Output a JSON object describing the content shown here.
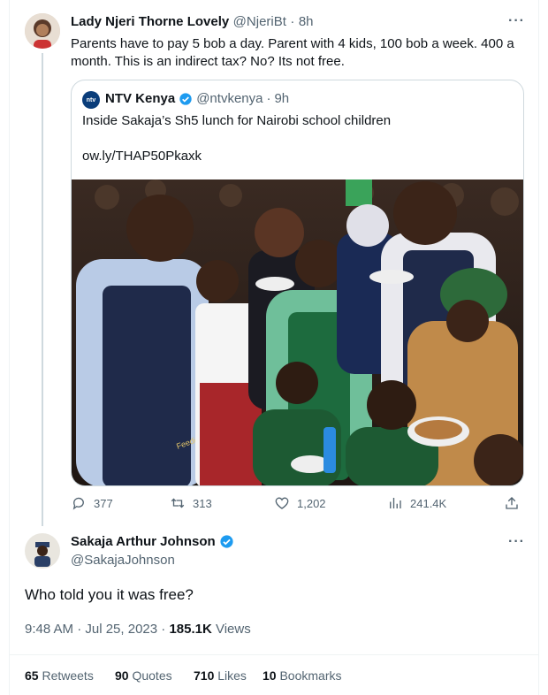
{
  "original_tweet": {
    "display_name": "Lady Njeri Thorne Lovely",
    "handle": "@NjeriBt",
    "separator": "·",
    "time": "8h",
    "more_label": "···",
    "text": "Parents have to pay 5 bob a day. Parent with 4 kids, 100 bob a week. 400 a month. This is an indirect tax? No? Its not free."
  },
  "quoted_tweet": {
    "display_name": "NTV Kenya",
    "handle": "@ntvkenya",
    "separator": "·",
    "time": "9h",
    "text": "Inside Sakaja’s Sh5 lunch for Nairobi school children",
    "link": "ow.ly/THAP50Pkaxk",
    "avatar_text": "ntv",
    "apron_text": "Feeding The Fut"
  },
  "actions": {
    "replies": "377",
    "retweets": "313",
    "likes": "1,202",
    "views": "241.4K"
  },
  "reply_tweet": {
    "display_name": "Sakaja Arthur Johnson",
    "handle": "@SakajaJohnson",
    "more_label": "···",
    "text": "Who told you it was free?",
    "timestamp": "9:48 AM · Jul 25, 2023 · ",
    "views_count": "185.1K",
    "views_label": " Views"
  },
  "stats": {
    "retweets_count": "65",
    "retweets_label": " Retweets",
    "quotes_count": "90",
    "quotes_label": " Quotes",
    "likes_count": "710",
    "likes_label": " Likes",
    "bookmarks_count": "10",
    "bookmarks_label": " Bookmarks"
  },
  "colors": {
    "verified_blue": "#1d9bf0",
    "muted": "#536471",
    "border": "#cfd9de"
  }
}
